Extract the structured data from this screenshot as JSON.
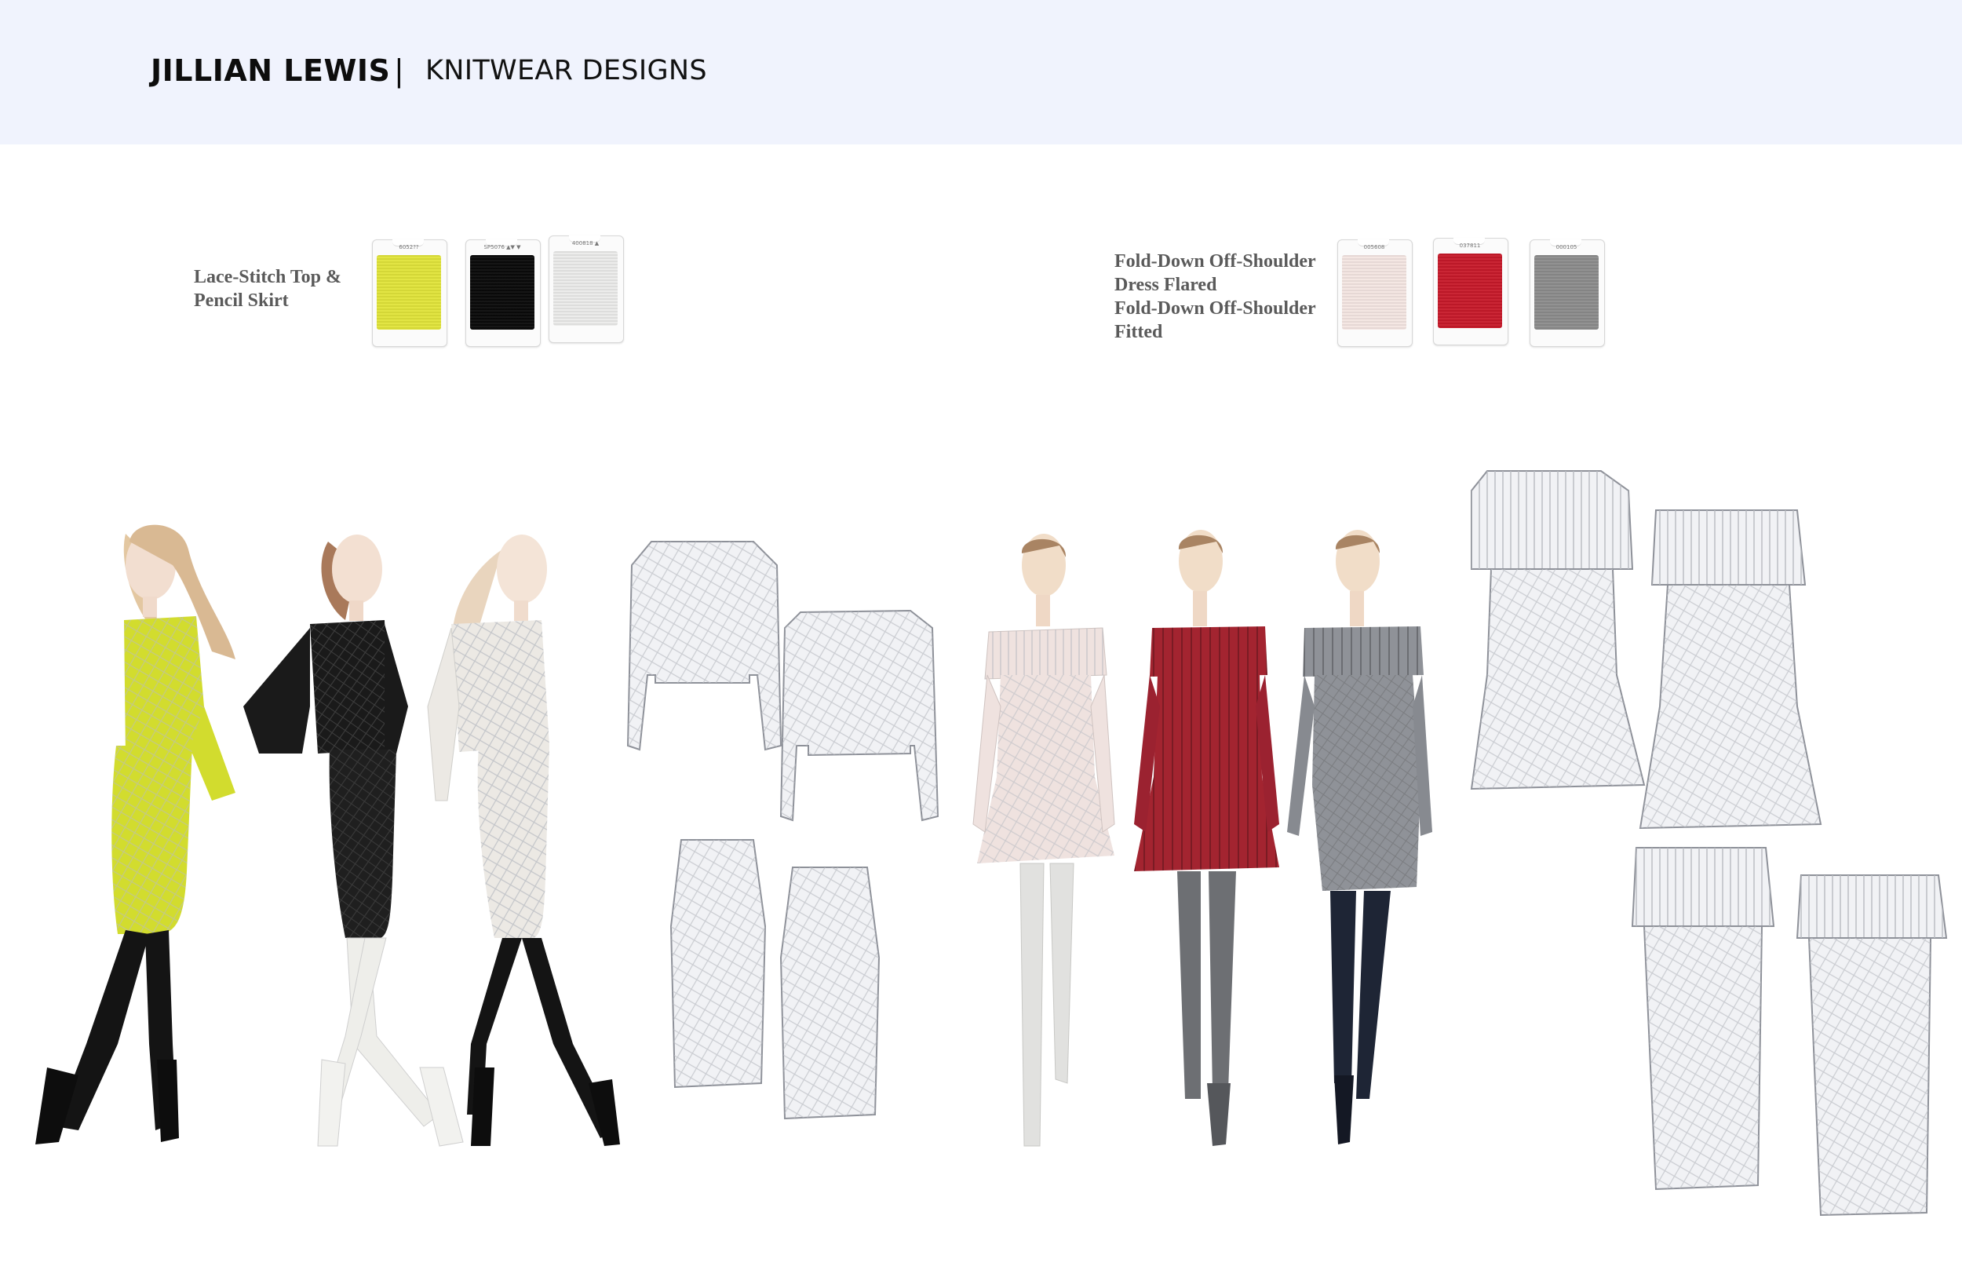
{
  "header": {
    "designer": "JILLIAN LEWIS",
    "separator": "|",
    "collection": "KNITWEAR DESIGNS"
  },
  "group1": {
    "label_lines": [
      "Lace-Stitch Top &",
      "Pencil Skirt"
    ],
    "spools": [
      {
        "code": "6052??",
        "color": "#e1e43a"
      },
      {
        "code": "SP5076 ▲▼ ▼",
        "color": "#0a0a0a"
      },
      {
        "code": "400818 ▲",
        "color": "#ebebea"
      }
    ]
  },
  "group2": {
    "label_lines": [
      "Fold-Down Off-Shoulder",
      "Dress Flared",
      "Fold-Down Off-Shoulder",
      "Fitted"
    ],
    "spools": [
      {
        "code": "005608",
        "color": "#f4e6e2"
      },
      {
        "code": "037811",
        "color": "#c71a2a"
      },
      {
        "code": "000105",
        "color": "#8c8c8c"
      }
    ]
  },
  "colors": {
    "header_bg": "#f0f3fd",
    "chartreuse": "#d2dc2e",
    "black": "#1a1a1a",
    "ivory": "#ece9e4",
    "blush": "#efe2df",
    "red": "#a32430",
    "grey": "#8f9298"
  }
}
